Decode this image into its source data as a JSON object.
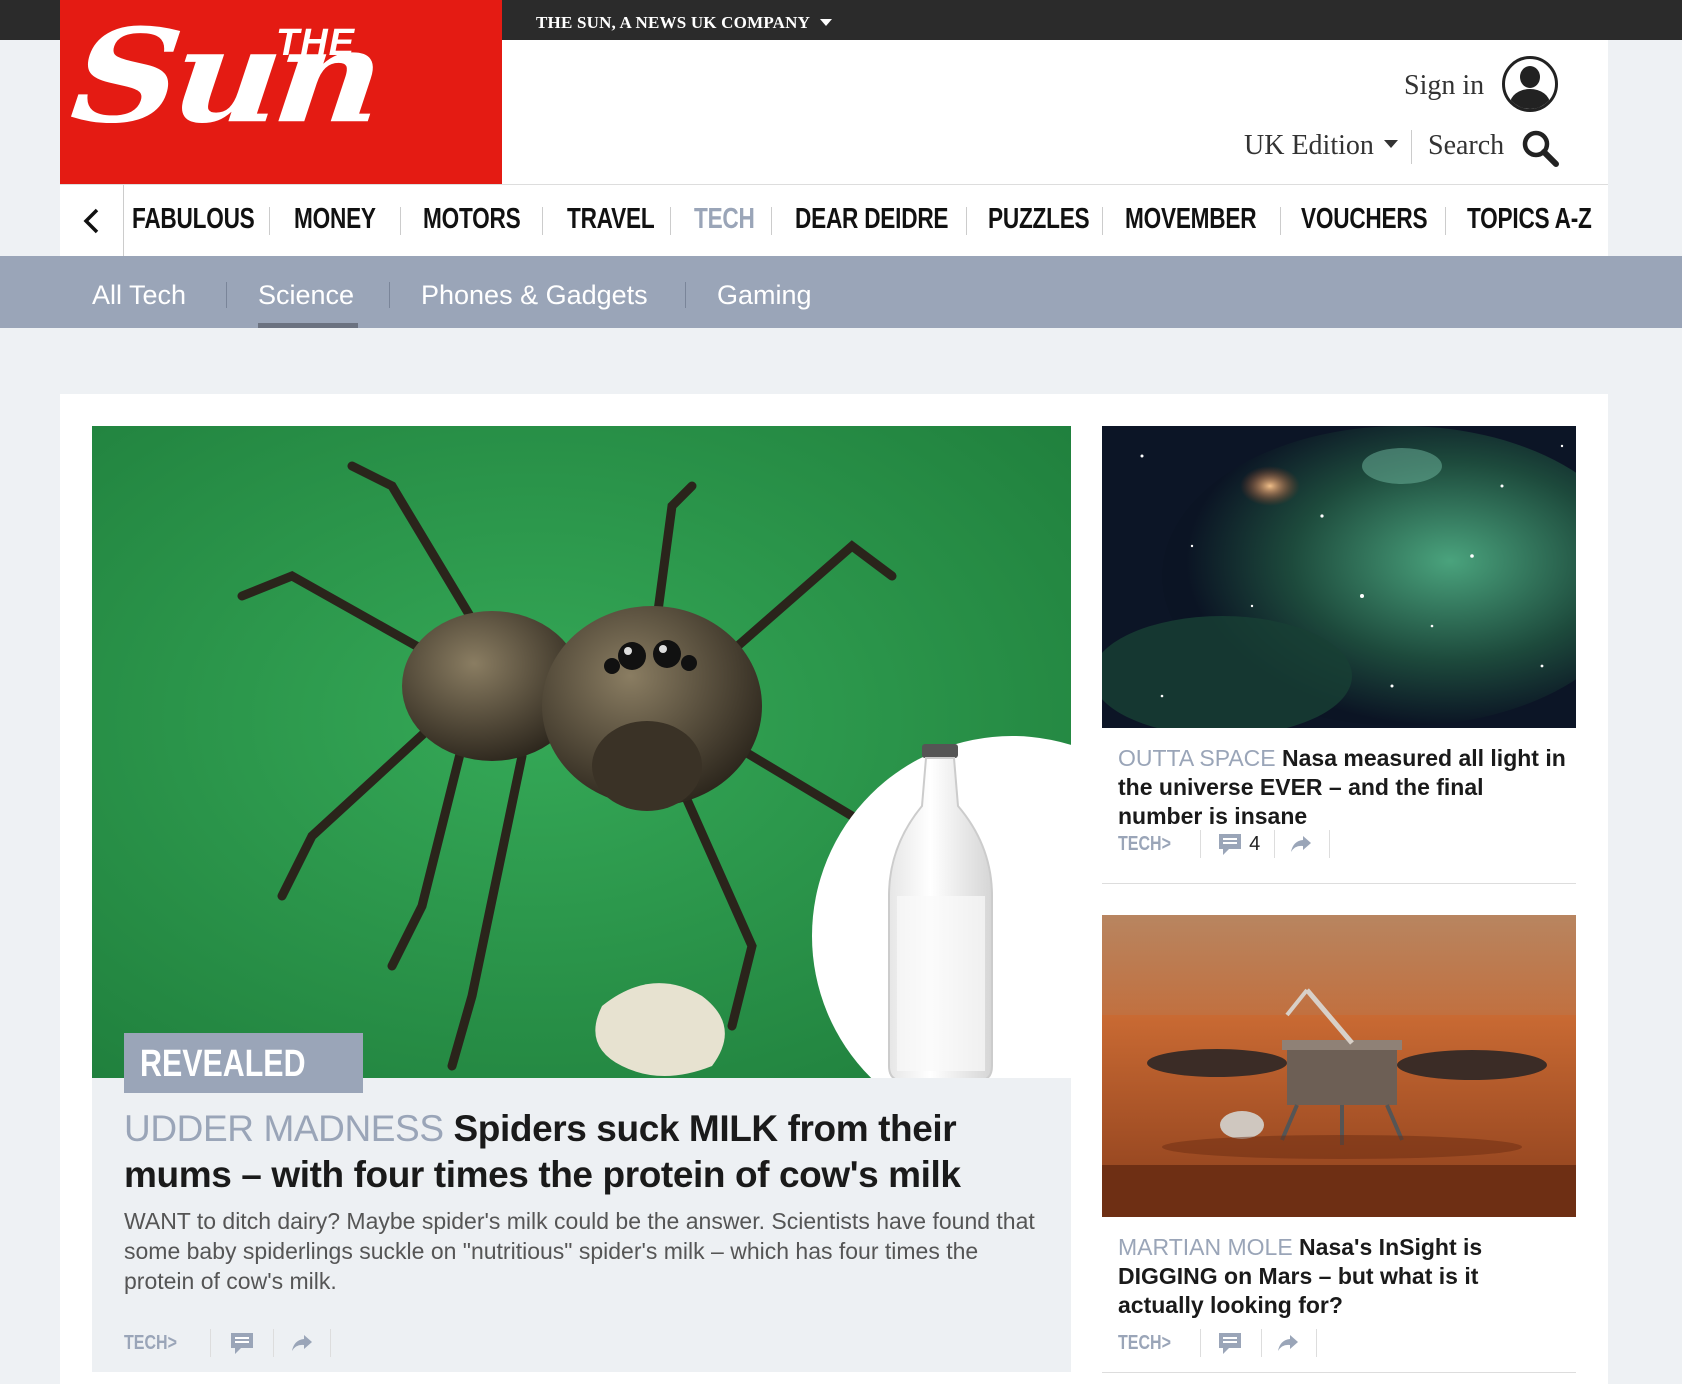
{
  "topbar": {
    "company": "THE SUN, A NEWS UK COMPANY"
  },
  "logo": {
    "the": "THE",
    "sun": "Sun"
  },
  "header": {
    "sign_in": "Sign in",
    "edition": "UK Edition",
    "search": "Search"
  },
  "main_nav": {
    "items": [
      {
        "label": "FABULOUS",
        "active": false
      },
      {
        "label": "MONEY",
        "active": false
      },
      {
        "label": "MOTORS",
        "active": false
      },
      {
        "label": "TRAVEL",
        "active": false
      },
      {
        "label": "TECH",
        "active": true
      },
      {
        "label": "DEAR DEIDRE",
        "active": false
      },
      {
        "label": "PUZZLES",
        "active": false
      },
      {
        "label": "MOVEMBER",
        "active": false
      },
      {
        "label": "VOUCHERS",
        "active": false
      },
      {
        "label": "TOPICS A-Z",
        "active": false
      }
    ]
  },
  "sub_nav": {
    "items": [
      {
        "label": "All Tech",
        "active": false
      },
      {
        "label": "Science",
        "active": true
      },
      {
        "label": "Phones & Gadgets",
        "active": false
      },
      {
        "label": "Gaming",
        "active": false
      }
    ]
  },
  "hero": {
    "badge": "REVEALED",
    "kicker": "UDDER MADNESS",
    "headline": "Spiders suck MILK from their mums – with four times the protein of cow's milk",
    "standfirst": "WANT to ditch dairy? Maybe spider's milk could be the answer. Scientists have found that some baby spiderlings suckle on \"nutritious\" spider's milk – which has four times the protein of cow's milk.",
    "tag": "TECH",
    "tag_arrow": ">"
  },
  "side_articles": [
    {
      "kicker": "OUTTA SPACE",
      "headline": "Nasa measured all light in the universe EVER – and the final number is insane",
      "tag": "TECH",
      "tag_arrow": ">",
      "comments": "4"
    },
    {
      "kicker": "MARTIAN MOLE",
      "headline": "Nasa's InSight is DIGGING on Mars – but what is it actually looking for?",
      "tag": "TECH",
      "tag_arrow": ">",
      "comments": ""
    }
  ],
  "colors": {
    "brand_red": "#e41b13",
    "accent_grey_blue": "#9aa5b8",
    "topbar": "#2b2b2b"
  },
  "icons": [
    "chevron-left-icon",
    "user-icon",
    "caret-down-icon",
    "search-icon",
    "comment-icon",
    "share-icon"
  ]
}
